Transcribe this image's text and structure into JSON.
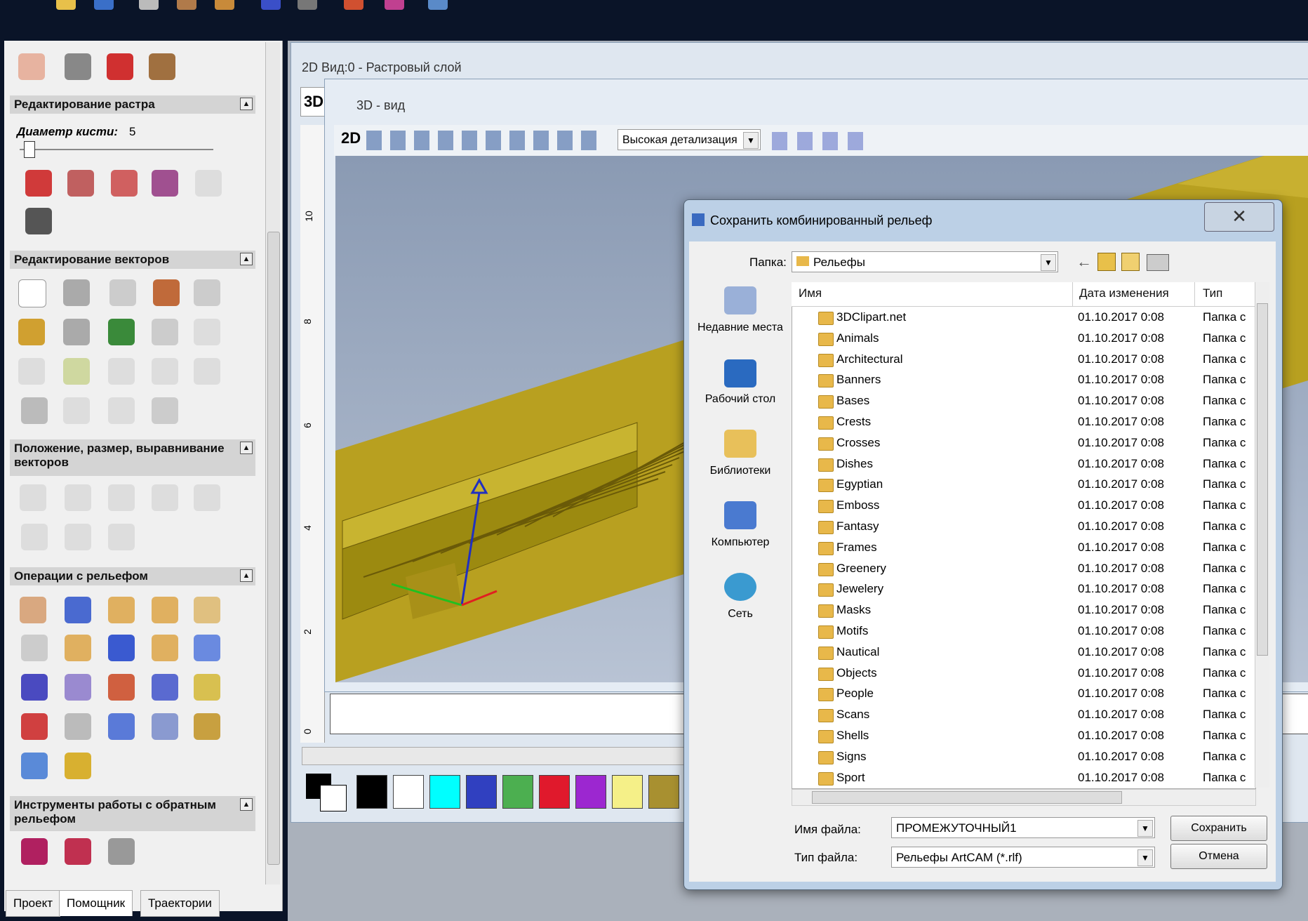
{
  "left_panel": {
    "raster_section": "Редактирование растра",
    "brush_label": "Диаметр кисти:",
    "brush_value": "5",
    "vector_section": "Редактирование векторов",
    "position_section": "Положение, размер, выравнивание векторов",
    "relief_section": "Операции с рельефом",
    "reverse_section": "Инструменты работы с обратным рельефом",
    "tabs": [
      "Проект",
      "Помощник",
      "Траектории"
    ]
  },
  "view2d": {
    "title": "2D Вид:0 - Растровый слой",
    "tab": "3D"
  },
  "view3d": {
    "title": "3D - вид",
    "mode_btn": "2D",
    "detail_select": "Высокая детализация"
  },
  "ruler_labels": [
    "10",
    "8",
    "6",
    "4",
    "2",
    "0"
  ],
  "palette": {
    "colors": [
      "#000000",
      "#ffffff",
      "#00ffff",
      "#3040c0",
      "#4caf50",
      "#e0192c",
      "#9c27d0",
      "#f5f088",
      "#a89030"
    ]
  },
  "dialog": {
    "title": "Сохранить комбинированный рельеф",
    "folder_label": "Папка:",
    "folder_value": "Рельефы",
    "places": [
      "Недавние места",
      "Рабочий стол",
      "Библиотеки",
      "Компьютер",
      "Сеть"
    ],
    "columns": {
      "name": "Имя",
      "date": "Дата изменения",
      "type": "Тип"
    },
    "files": [
      {
        "name": "3DClipart.net",
        "date": "01.10.2017 0:08",
        "type": "Папка с"
      },
      {
        "name": "Animals",
        "date": "01.10.2017 0:08",
        "type": "Папка с"
      },
      {
        "name": "Architectural",
        "date": "01.10.2017 0:08",
        "type": "Папка с"
      },
      {
        "name": "Banners",
        "date": "01.10.2017 0:08",
        "type": "Папка с"
      },
      {
        "name": "Bases",
        "date": "01.10.2017 0:08",
        "type": "Папка с"
      },
      {
        "name": "Crests",
        "date": "01.10.2017 0:08",
        "type": "Папка с"
      },
      {
        "name": "Crosses",
        "date": "01.10.2017 0:08",
        "type": "Папка с"
      },
      {
        "name": "Dishes",
        "date": "01.10.2017 0:08",
        "type": "Папка с"
      },
      {
        "name": "Egyptian",
        "date": "01.10.2017 0:08",
        "type": "Папка с"
      },
      {
        "name": "Emboss",
        "date": "01.10.2017 0:08",
        "type": "Папка с"
      },
      {
        "name": "Fantasy",
        "date": "01.10.2017 0:08",
        "type": "Папка с"
      },
      {
        "name": "Frames",
        "date": "01.10.2017 0:08",
        "type": "Папка с"
      },
      {
        "name": "Greenery",
        "date": "01.10.2017 0:08",
        "type": "Папка с"
      },
      {
        "name": "Jewelery",
        "date": "01.10.2017 0:08",
        "type": "Папка с"
      },
      {
        "name": "Masks",
        "date": "01.10.2017 0:08",
        "type": "Папка с"
      },
      {
        "name": "Motifs",
        "date": "01.10.2017 0:08",
        "type": "Папка с"
      },
      {
        "name": "Nautical",
        "date": "01.10.2017 0:08",
        "type": "Папка с"
      },
      {
        "name": "Objects",
        "date": "01.10.2017 0:08",
        "type": "Папка с"
      },
      {
        "name": "People",
        "date": "01.10.2017 0:08",
        "type": "Папка с"
      },
      {
        "name": "Scans",
        "date": "01.10.2017 0:08",
        "type": "Папка с"
      },
      {
        "name": "Shells",
        "date": "01.10.2017 0:08",
        "type": "Папка с"
      },
      {
        "name": "Signs",
        "date": "01.10.2017 0:08",
        "type": "Папка с"
      },
      {
        "name": "Sport",
        "date": "01.10.2017 0:08",
        "type": "Папка с"
      }
    ],
    "filename_label": "Имя файла:",
    "filename_value": "ПРОМЕЖУТОЧНЫЙ1",
    "filetype_label": "Тип файла:",
    "filetype_value": "Рельефы ArtCAM (*.rlf)",
    "save_btn": "Сохранить",
    "cancel_btn": "Отмена"
  }
}
